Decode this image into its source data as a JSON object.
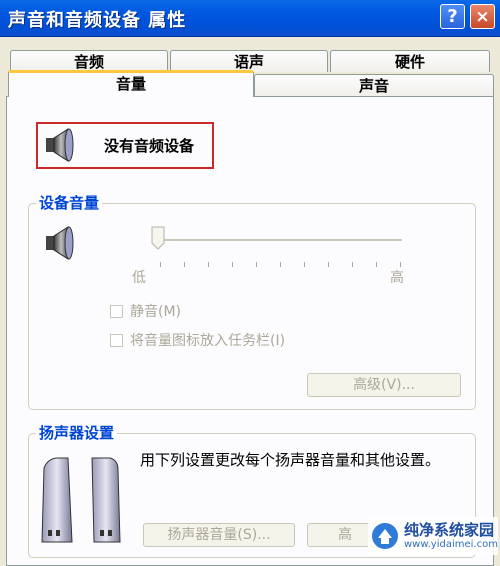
{
  "window": {
    "title": "声音和音频设备 属性"
  },
  "titlebar": {
    "help_label": "?",
    "close_label": "×"
  },
  "tabs": {
    "top_row": [
      {
        "label": "音频"
      },
      {
        "label": "语声"
      },
      {
        "label": "硬件"
      }
    ],
    "bottom_row": [
      {
        "label": "音量",
        "active": true
      },
      {
        "label": "声音",
        "active": false
      }
    ]
  },
  "device": {
    "label": "没有音频设备",
    "icon": "speaker-icon"
  },
  "device_volume": {
    "legend": "设备音量",
    "slider_low_label": "低",
    "slider_high_label": "高",
    "slider_level": 0,
    "mute_label": "静音(M)",
    "mute_checked": false,
    "taskbar_label": "将音量图标放入任务栏(I)",
    "taskbar_checked": false,
    "advanced_label": "高级(V)..."
  },
  "speaker_settings": {
    "legend": "扬声器设置",
    "description": "用下列设置更改每个扬声器音量和其他设置。",
    "speaker_volume_label": "扬声器音量(S)...",
    "advanced_label_partial": "高"
  },
  "watermark": {
    "title": "纯净系统家园",
    "url": "www.yidaimei.com"
  },
  "colors": {
    "titlebar": "#0058e0",
    "accent_tab": "#ffc83c",
    "legend": "#0046d5",
    "highlight_box": "#cc2a2a"
  }
}
